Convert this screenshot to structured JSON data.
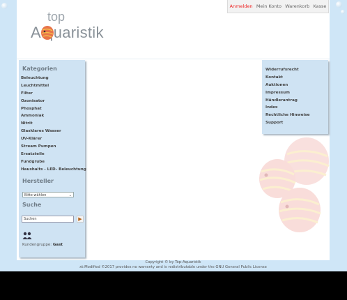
{
  "header": {
    "links": [
      "Anmelden",
      "Mein Konto",
      "Warenkorb",
      "Kasse"
    ],
    "logo_top": "top",
    "logo_bottom": "A quaristik"
  },
  "left": {
    "categories_title": "Kategorien",
    "categories": [
      "Beleuchtung",
      "Leuchtmittel",
      "Filter",
      "Ozonisator",
      "Phosphat",
      "Ammoniak",
      "Nitrit",
      "Glasklares Wasser",
      "UV-Klärer",
      "Stream Pumpen",
      "Ersatzteile",
      "Fundgrube",
      "Haushalts - LED- Beleuchtung"
    ],
    "manufacturer_title": "Hersteller",
    "manufacturer_select": "Bitte wählen",
    "search_title": "Suche",
    "search_value": "Suchen",
    "customer_group_label": "Kundengruppe:",
    "customer_group_value": "Gast"
  },
  "right": {
    "links": [
      "Widerrufsrecht",
      "Kontakt",
      "Auktionen",
      "Impressum",
      "Händlerantrag",
      "Index",
      "Rechtliche Hinweise",
      "Support"
    ]
  },
  "footer": {
    "copyright": "Copyright © by Top-Aquaristik",
    "license": "xt:Modified ©2017 provides no warranty and is redistributable under the GNU General Public License"
  },
  "colors": {
    "active_link": "#ee2222",
    "sidebar_bg": "#cfe3f3",
    "page_bg": "#cfe6f7"
  }
}
